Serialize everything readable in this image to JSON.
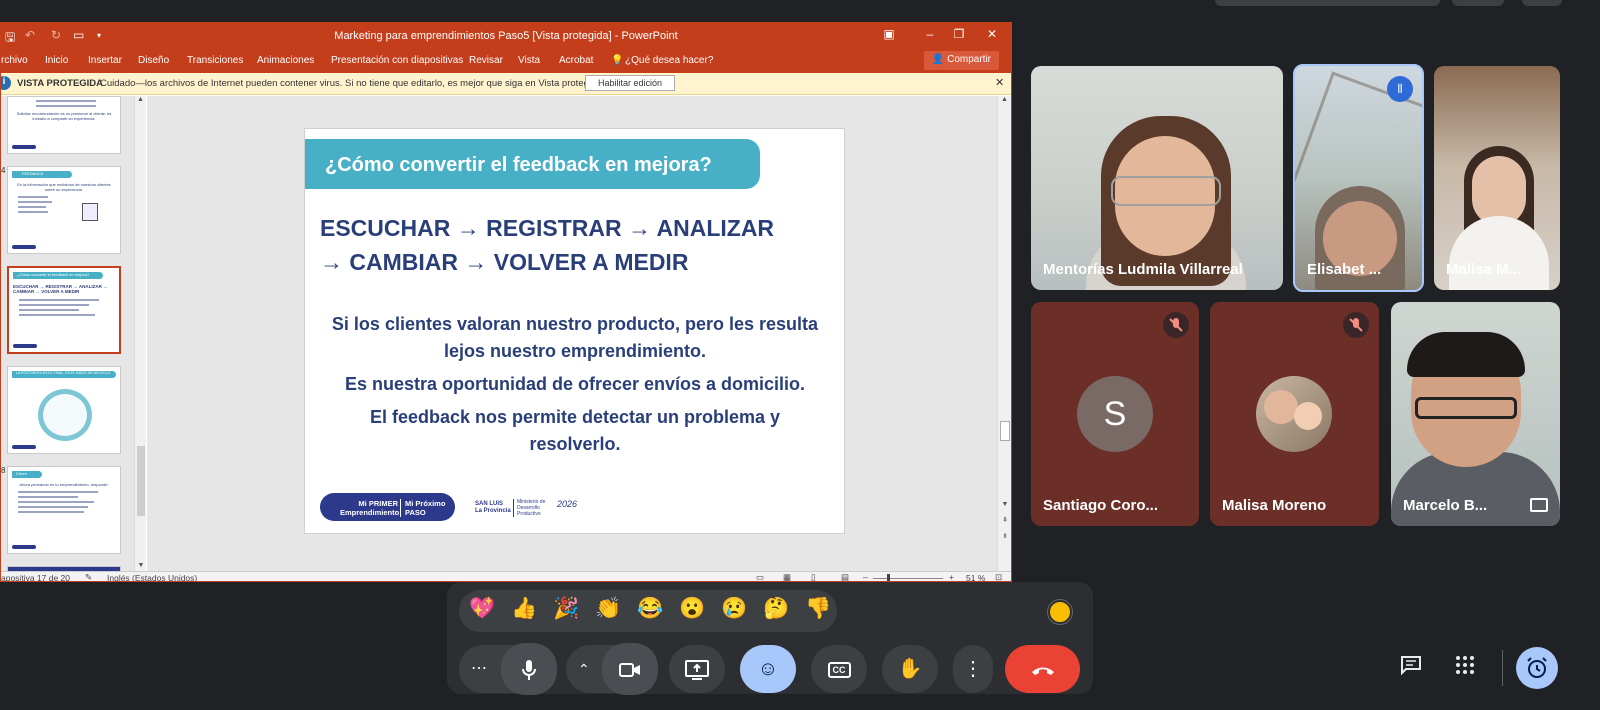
{
  "colors": {
    "ppt_accent": "#c43e1c",
    "slide_teal": "#48b0c6",
    "slide_navy": "#2a3f7a",
    "meet_bg": "#202124",
    "leave_red": "#ea4335",
    "reactions_active": "#a8c7fa"
  },
  "ppt": {
    "title": "Marketing para emprendimientos Paso5 [Vista protegida] - PowerPoint",
    "menu": [
      "rchivo",
      "Inicio",
      "Insertar",
      "Diseño",
      "Transiciones",
      "Animaciones",
      "Presentación con diapositivas",
      "Revisar",
      "Vista",
      "Acrobat"
    ],
    "search": "¿Qué desea hacer?",
    "share": "Compartir",
    "protected": {
      "label": "VISTA PROTEGIDA",
      "message": "Cuidado—los archivos de Internet pueden contener virus. Si no tiene que editarlo, es mejor que siga en Vista protegida.",
      "button": "Habilitar edición"
    },
    "slide": {
      "title": "¿Cómo convertir el feedback en mejora?",
      "main_line1": "ESCUCHAR → REGISTRAR → ANALIZAR",
      "main_line2": "→ CAMBIAR → VOLVER A MEDIR",
      "p1": "Si los clientes valoran nuestro producto, pero les resulta lejos nuestro emprendimiento.",
      "p2": "Es nuestra oportunidad de ofrecer envíos a domicilio.",
      "p3": "El feedback nos permite detectar un problema y resolverlo.",
      "logo_a": "Mi PRIMER Emprendimiento",
      "logo_b": "Mi Próximo PASO",
      "logo_sl": "SAN LUIS La Provincia",
      "logo_min": "Ministerio de Desarrollo Productivo",
      "logo_26": "2026"
    },
    "thumbs": [
      {
        "title": "",
        "text": "Solicitar recomendación es no presionar al cliente, es invitarlo a compartir su experiencia."
      },
      {
        "title": "FEEDBACK",
        "text": "Es la información que recibimos de nuestros clientes sobre su experiencia."
      },
      {
        "title": "¿Cómo convertir el feedback en mejora?",
        "text": "ESCUCHAR → REGISTRAR → ANALIZAR → CAMBIAR → VOLVER A MEDIR"
      },
      {
        "title": "LA POSTVENTA ES EL FINAL, ES EL INICIO DE UN CICLO",
        "text": ""
      },
      {
        "title": "Cierre",
        "text": "Ahora pensando en tu emprendimiento, responde:"
      }
    ],
    "status": {
      "slide": "apositiva 17 de 20",
      "language": "Inglés (Estados Unidos)",
      "zoom": "51 %"
    }
  },
  "meet": {
    "participants": [
      {
        "name": "Mentorías Ludmila Villarreal"
      },
      {
        "name": "Elisabet ..."
      },
      {
        "name": "Malisa M..."
      },
      {
        "name": "Santiago Coro...",
        "initial": "S"
      },
      {
        "name": "Malisa Moreno"
      },
      {
        "name": "Marcelo B..."
      }
    ],
    "reactions": [
      "💖",
      "👍",
      "🎉",
      "👏",
      "😂",
      "😮",
      "😢",
      "🤔",
      "👎"
    ]
  }
}
